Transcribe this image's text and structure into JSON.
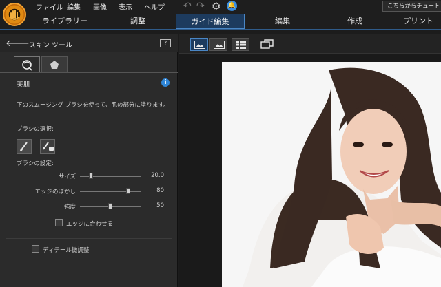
{
  "menu": {
    "items": [
      "ファイル",
      "編集",
      "画像",
      "表示",
      "ヘルプ"
    ],
    "tutorial_label": "こちらからチュートリアル"
  },
  "tabs": [
    {
      "label": "ライブラリー",
      "active": false
    },
    {
      "label": "調整",
      "active": false
    },
    {
      "label": "ガイド編集",
      "active": true
    },
    {
      "label": "編集",
      "active": false
    },
    {
      "label": "作成",
      "active": false
    },
    {
      "label": "プリント",
      "active": false
    }
  ],
  "panel": {
    "title": "スキン ツール",
    "section_title": "美肌",
    "description": "下のスムージング ブラシを使って、肌の部分に塗ります。",
    "brush_select_label": "ブラシの選択:",
    "brush_settings_label": "ブラシの設定:",
    "sliders": [
      {
        "label": "サイズ",
        "value": "20.0",
        "level": 0.18
      },
      {
        "label": "エッジのぼかし",
        "value": "80",
        "level": 0.8
      },
      {
        "label": "強度",
        "value": "50",
        "level": 0.5
      }
    ],
    "edge_fit_label": "エッジに合わせる",
    "detail_label": "ディテール微調整"
  },
  "colors": {
    "accent": "#2f86d8",
    "active_tab_bg": "#1d3b5e",
    "panel_bg": "#2b2b2b"
  }
}
